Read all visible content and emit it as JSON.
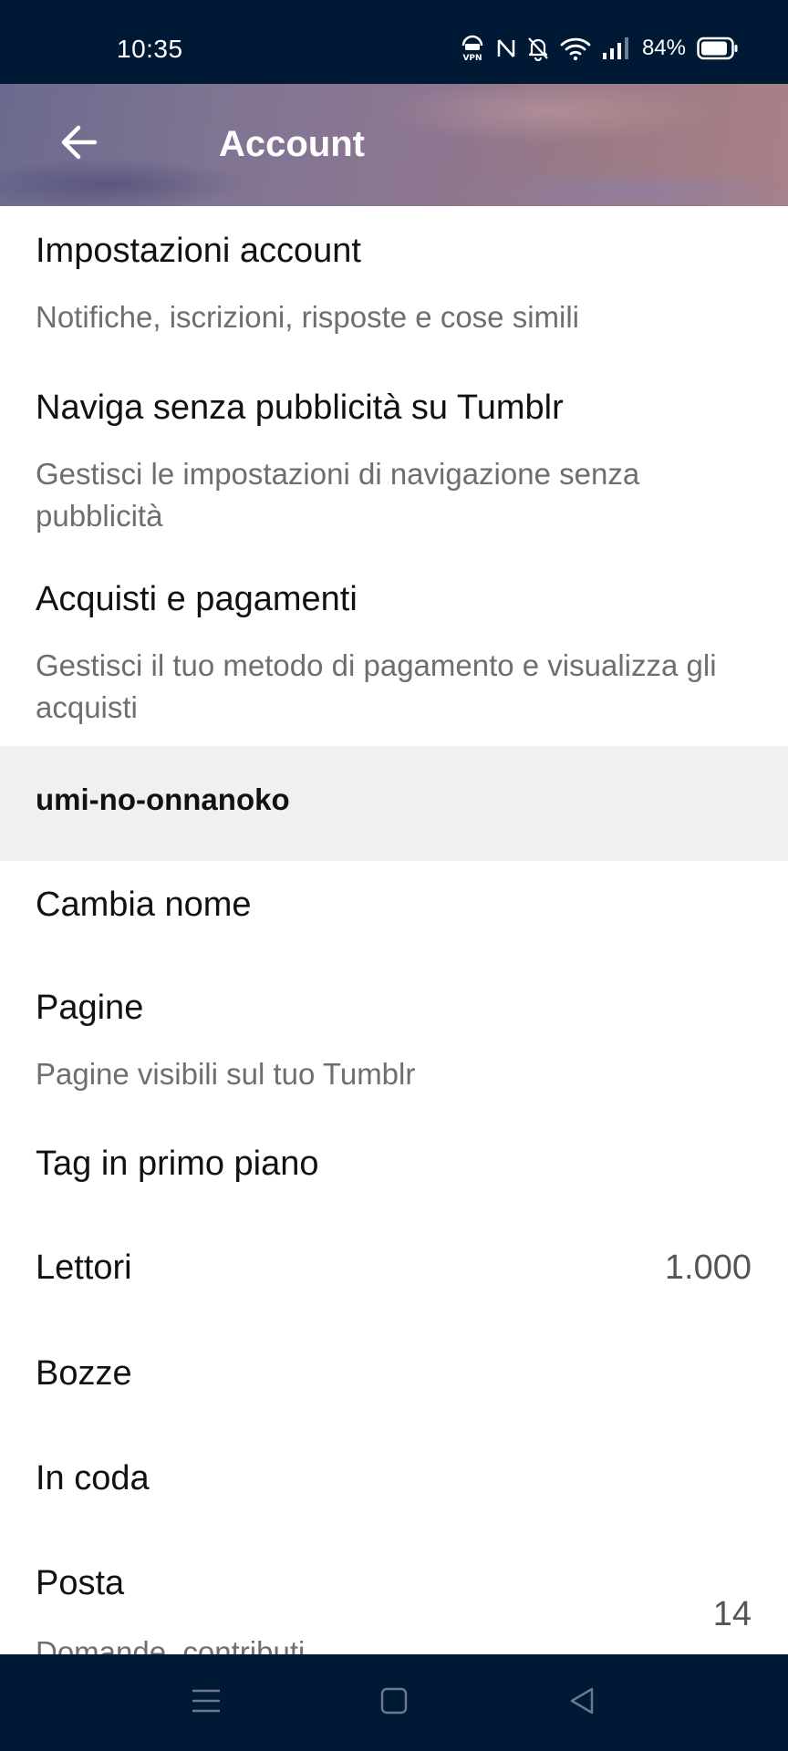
{
  "status_bar": {
    "time": "10:35",
    "battery": "84%",
    "icons": [
      "vpn-icon",
      "nfc-icon",
      "bell-off-icon",
      "wifi-icon",
      "signal-icon",
      "battery-icon"
    ]
  },
  "header": {
    "title": "Account",
    "back_icon": "arrow-left-icon"
  },
  "items": {
    "account_settings": {
      "title": "Impostazioni account",
      "subtitle": "Notifiche, iscrizioni, risposte e cose simili"
    },
    "ad_free": {
      "title": "Naviga senza pubblicità su Tumblr",
      "subtitle": "Gestisci le impostazioni di navigazione senza pubblicità"
    },
    "purchases": {
      "title": "Acquisti e pagamenti",
      "subtitle": "Gestisci il tuo metodo di pagamento e visualizza gli acquisti"
    },
    "blog_section": {
      "title": "umi-no-onnanoko"
    },
    "change_name": {
      "title": "Cambia nome"
    },
    "pages": {
      "title": "Pagine",
      "subtitle": "Pagine visibili sul tuo Tumblr"
    },
    "featured_tags": {
      "title": "Tag in primo piano"
    },
    "followers": {
      "title": "Lettori",
      "value": "1.000"
    },
    "drafts": {
      "title": "Bozze"
    },
    "queue": {
      "title": "In coda"
    },
    "inbox": {
      "title": "Posta",
      "subtitle": "Domande, contributi",
      "value": "14"
    }
  },
  "nav_bar": {
    "icons": [
      "menu-icon",
      "home-square-icon",
      "back-triangle-icon"
    ]
  },
  "colors": {
    "status_bg": "#001935",
    "nav_bg": "#001935",
    "section_bg": "#f0f0f0",
    "text_primary": "#111111",
    "text_secondary": "#6e6e6e"
  }
}
